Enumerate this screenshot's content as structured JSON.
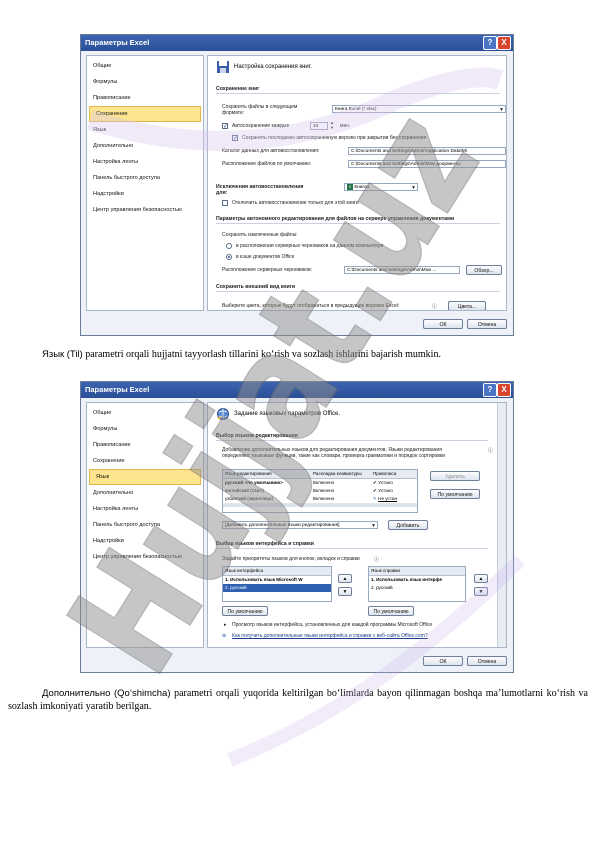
{
  "dialog1": {
    "title": "Параметры Excel",
    "help": "?",
    "close": "X",
    "nav": [
      "Общие",
      "Формулы",
      "Правописание",
      "Сохранение",
      "Язык",
      "Дополнительно",
      "Настройка ленты",
      "Панель быстрого доступа",
      "Надстройки",
      "Центр управления безопасностью"
    ],
    "header": "Настройка сохранения книг.",
    "sec_save": "Сохранение книг",
    "save_format_label": "Сохранять файлы в следующем формате:",
    "save_format_value": "Книга Excel (*.xlsx)",
    "autosave_label": "Автосохранение каждые",
    "autosave_value": "10",
    "autosave_unit": "мин.",
    "keep_last_label": "Сохранять последнюю автосохраненную версию при закрытии без сохранения",
    "autorecover_dir_label": "Каталог данных для автовосстановления:",
    "autorecover_dir_value": "C:\\Documents and Settings\\Admin\\Application Data\\Mi",
    "default_dir_label": "Расположение файлов по умолчанию:",
    "default_dir_value": "C:\\Documents and Settings\\Admin\\Мои документы",
    "sec_exceptions": "Исключения автовосстановления для:",
    "exceptions_value": "Книга1",
    "disable_autorecover_label": "Отключить автовосстановление только для этой книги",
    "sec_offline": "Параметры автономного редактирования для файлов на сервере управления документами",
    "save_checked_out_label": "Сохранять извлеченные файлы:",
    "radio1": "в расположении серверных черновиков на данном компьютере",
    "radio2": "в кэше документов Office",
    "drafts_label": "Расположение серверных черновиков:",
    "drafts_value": "C:\\Documents and Settings\\Admin\\Мои ...",
    "browse_button": "Обзор...",
    "sec_visual": "Сохранить внешний вид книги",
    "colors_label": "Выберите цвета, которые будут отображаться в предыдущих версиях Excel:",
    "colors_button": "Цвета...",
    "ok": "ОК",
    "cancel": "Отмена"
  },
  "para1": {
    "lead": "Язык",
    "term": "(Til)",
    "rest": " parametri orqali hujjatni tayyorlash tillarini ko‘rish va sozlash ishlarini bajarish mumkin."
  },
  "dialog2": {
    "title": "Параметры Excel",
    "help": "?",
    "close": "X",
    "nav": [
      "Общие",
      "Формулы",
      "Правописание",
      "Сохранение",
      "Язык",
      "Дополнительно",
      "Настройка ленты",
      "Панель быстрого доступа",
      "Надстройки",
      "Центр управления безопасностью"
    ],
    "header": "Задание языковых параметров Office.",
    "sec_edit": "Выбор языков редактирования",
    "edit_desc": "Добавление дополнительных языков для редактирования документов. Языки редактирования определяют языковые функции, такие как словари, проверка грамматики и порядок сортировки",
    "col_lang": "Язык редактирования",
    "col_kbd": "Раскладка клавиатуры",
    "col_spell": "Правописа",
    "rows": [
      {
        "lang": "русский <по умолчанию>",
        "kbd": "Включено",
        "spell": "Устано"
      },
      {
        "lang": "английский (США)",
        "kbd": "Включено",
        "spell": "Устано"
      },
      {
        "lang": "узбекский (кириллица)",
        "kbd": "Включено",
        "spell": "Не устан"
      }
    ],
    "remove_button": "Удалить",
    "default_button": "По умолчанию",
    "add_select": "[Добавить дополнительные языки редактирования]",
    "add_button": "Добавить",
    "sec_ui": "Выбор языков интерфейса и справки",
    "ui_desc": "Задайте приоритеты языков для кнопок, вкладок и справки",
    "ui_col": "Язык интерфейса",
    "ui_items": [
      "1.   Использовать язык Microsoft W",
      "2.   русский"
    ],
    "help_col": "Язык справки",
    "help_items": [
      "1.   Использовать язык интерфе",
      "2.   русский"
    ],
    "ui_default": "По умолчанию",
    "help_default": "По умолчанию",
    "view_link": "Просмотр языков интерфейса, установленных для каждой программы Microsoft Office",
    "get_link": "Как получить дополнительные языки интерфейса и справки с веб-сайта Office.com?",
    "ok": "ОК",
    "cancel": "Отмена"
  },
  "para2": {
    "lead": "Дополнительно",
    "term": "(Qo‘shimcha)",
    "rest": " parametri orqali yuqorida keltirilgan bo‘limlarda bayon qilinmagan boshqa ma’lumotlarni ko‘rish va sozlash imkoniyati yaratib berilgan."
  },
  "watermark": "Hujjat.uz"
}
